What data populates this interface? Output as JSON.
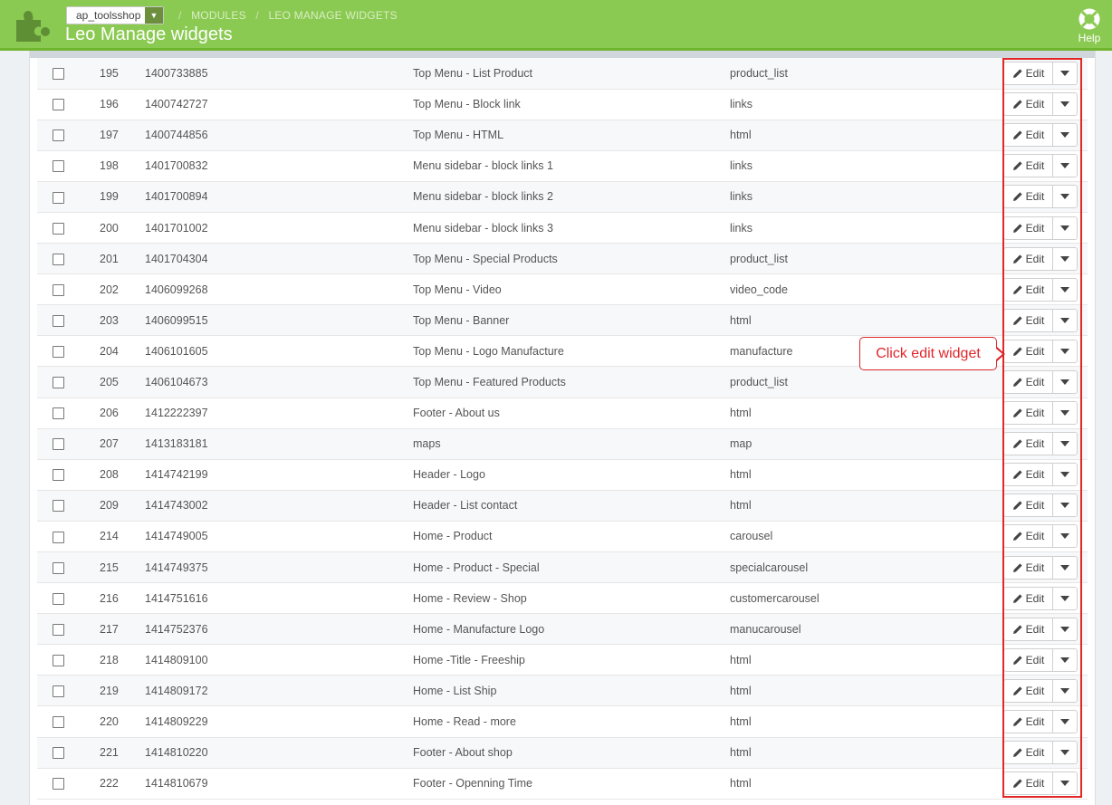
{
  "header": {
    "shop": "ap_toolsshop",
    "breadcrumbs": [
      "MODULES",
      "LEO MANAGE WIDGETS"
    ],
    "separator": "/",
    "title": "Leo Manage widgets",
    "help_label": "Help",
    "color_brand": "#8bca52"
  },
  "table": {
    "edit_label": "Edit",
    "rows": [
      {
        "id": "195",
        "key": "1400733885",
        "name": "Top Menu - List Product",
        "type": "product_list"
      },
      {
        "id": "196",
        "key": "1400742727",
        "name": "Top Menu - Block link",
        "type": "links"
      },
      {
        "id": "197",
        "key": "1400744856",
        "name": "Top Menu - HTML",
        "type": "html"
      },
      {
        "id": "198",
        "key": "1401700832",
        "name": "Menu sidebar - block links 1",
        "type": "links"
      },
      {
        "id": "199",
        "key": "1401700894",
        "name": "Menu sidebar - block links 2",
        "type": "links"
      },
      {
        "id": "200",
        "key": "1401701002",
        "name": "Menu sidebar - block links 3",
        "type": "links"
      },
      {
        "id": "201",
        "key": "1401704304",
        "name": "Top Menu - Special Products",
        "type": "product_list"
      },
      {
        "id": "202",
        "key": "1406099268",
        "name": "Top Menu - Video",
        "type": "video_code"
      },
      {
        "id": "203",
        "key": "1406099515",
        "name": "Top Menu - Banner",
        "type": "html"
      },
      {
        "id": "204",
        "key": "1406101605",
        "name": "Top Menu - Logo Manufacture",
        "type": "manufacture"
      },
      {
        "id": "205",
        "key": "1406104673",
        "name": "Top Menu - Featured Products",
        "type": "product_list"
      },
      {
        "id": "206",
        "key": "1412222397",
        "name": "Footer - About us",
        "type": "html"
      },
      {
        "id": "207",
        "key": "1413183181",
        "name": "maps",
        "type": "map"
      },
      {
        "id": "208",
        "key": "1414742199",
        "name": "Header - Logo",
        "type": "html"
      },
      {
        "id": "209",
        "key": "1414743002",
        "name": "Header - List contact",
        "type": "html"
      },
      {
        "id": "214",
        "key": "1414749005",
        "name": "Home - Product",
        "type": "carousel"
      },
      {
        "id": "215",
        "key": "1414749375",
        "name": "Home - Product - Special",
        "type": "specialcarousel"
      },
      {
        "id": "216",
        "key": "1414751616",
        "name": "Home - Review - Shop",
        "type": "customercarousel"
      },
      {
        "id": "217",
        "key": "1414752376",
        "name": "Home - Manufacture Logo",
        "type": "manucarousel"
      },
      {
        "id": "218",
        "key": "1414809100",
        "name": "Home -Title - Freeship",
        "type": "html"
      },
      {
        "id": "219",
        "key": "1414809172",
        "name": "Home - List Ship",
        "type": "html"
      },
      {
        "id": "220",
        "key": "1414809229",
        "name": "Home - Read - more",
        "type": "html"
      },
      {
        "id": "221",
        "key": "1414810220",
        "name": "Footer - About shop",
        "type": "html"
      },
      {
        "id": "222",
        "key": "1414810679",
        "name": "Footer - Openning Time",
        "type": "html"
      }
    ]
  },
  "annotation": {
    "callout_text": "Click edit widget",
    "color_annotation": "#e32727"
  }
}
